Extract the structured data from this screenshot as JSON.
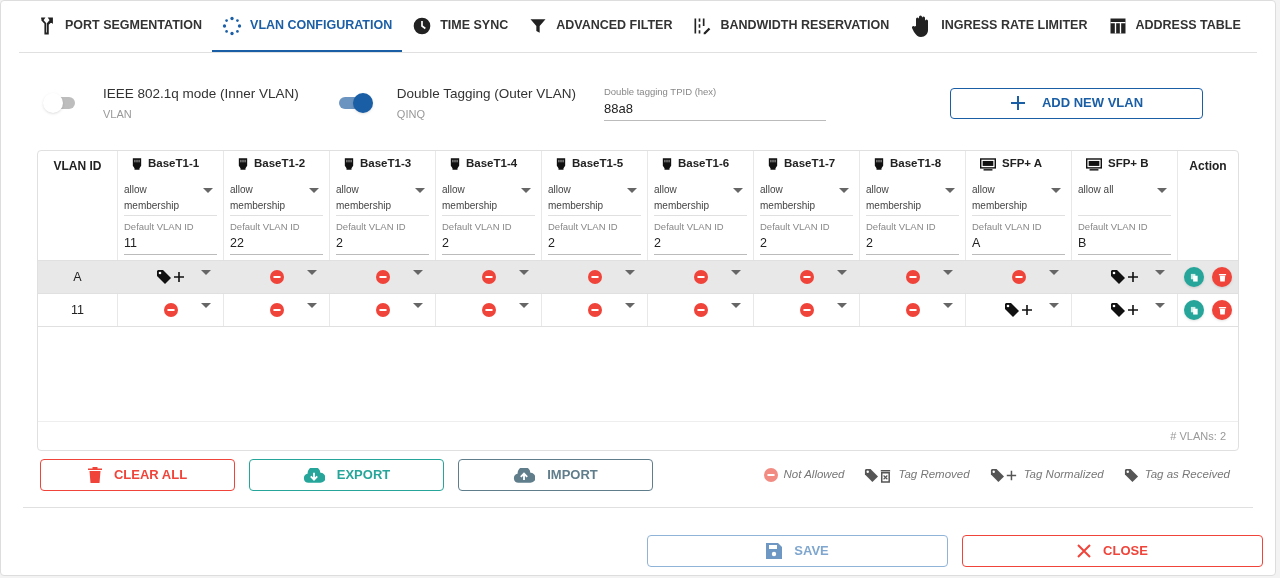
{
  "tabs": [
    {
      "label": "PORT SEGMENTATION",
      "kind": "fork",
      "selected": false
    },
    {
      "label": "VLAN CONFIGURATION",
      "kind": "dots",
      "selected": true
    },
    {
      "label": "TIME SYNC",
      "kind": "clock",
      "selected": false
    },
    {
      "label": "ADVANCED FILTER",
      "kind": "filter",
      "selected": false
    },
    {
      "label": "BANDWIDTH RESERVATION",
      "kind": "bars",
      "selected": false
    },
    {
      "label": "INGRESS RATE LIMITER",
      "kind": "hand",
      "selected": false
    },
    {
      "label": "ADDRESS TABLE",
      "kind": "table",
      "selected": false
    }
  ],
  "modes": [
    {
      "label": "IEEE 802.1q mode (Inner VLAN)",
      "sublabel": "VLAN",
      "on": false
    },
    {
      "label": "Double Tagging (Outer VLAN)",
      "sublabel": "QINQ",
      "on": true
    }
  ],
  "tpid_field": {
    "label": "Double tagging TPID (hex)",
    "value": "88a8"
  },
  "add_button": "ADD NEW VLAN",
  "table": {
    "id_heading": "VLAN ID",
    "action_heading": "Action",
    "ports": [
      {
        "name": "BaseT1-1",
        "kind": "ethernet",
        "mode": "allow membership",
        "default_label": "Default VLAN ID",
        "default_vlan": "11"
      },
      {
        "name": "BaseT1-2",
        "kind": "ethernet",
        "mode": "allow membership",
        "default_label": "Default VLAN ID",
        "default_vlan": "22"
      },
      {
        "name": "BaseT1-3",
        "kind": "ethernet",
        "mode": "allow membership",
        "default_label": "Default VLAN ID",
        "default_vlan": "2"
      },
      {
        "name": "BaseT1-4",
        "kind": "ethernet",
        "mode": "allow membership",
        "default_label": "Default VLAN ID",
        "default_vlan": "2"
      },
      {
        "name": "BaseT1-5",
        "kind": "ethernet",
        "mode": "allow membership",
        "default_label": "Default VLAN ID",
        "default_vlan": "2"
      },
      {
        "name": "BaseT1-6",
        "kind": "ethernet",
        "mode": "allow membership",
        "default_label": "Default VLAN ID",
        "default_vlan": "2"
      },
      {
        "name": "BaseT1-7",
        "kind": "ethernet",
        "mode": "allow membership",
        "default_label": "Default VLAN ID",
        "default_vlan": "2"
      },
      {
        "name": "BaseT1-8",
        "kind": "ethernet",
        "mode": "allow membership",
        "default_label": "Default VLAN ID",
        "default_vlan": "2"
      },
      {
        "name": "SFP+ A",
        "kind": "sfp",
        "mode": "allow membership",
        "default_label": "Default VLAN ID",
        "default_vlan": "A"
      },
      {
        "name": "SFP+ B",
        "kind": "sfp",
        "mode": "allow all",
        "default_label": "Default VLAN ID",
        "default_vlan": "B"
      }
    ],
    "rows": [
      {
        "vlan_id": "A",
        "selected": true,
        "cells": [
          {
            "kind": "tag_normalized"
          },
          {
            "kind": "not_allowed"
          },
          {
            "kind": "not_allowed"
          },
          {
            "kind": "not_allowed"
          },
          {
            "kind": "not_allowed"
          },
          {
            "kind": "not_allowed"
          },
          {
            "kind": "not_allowed"
          },
          {
            "kind": "not_allowed"
          },
          {
            "kind": "not_allowed"
          },
          {
            "kind": "tag_normalized"
          }
        ]
      },
      {
        "vlan_id": "11",
        "selected": false,
        "cells": [
          {
            "kind": "not_allowed"
          },
          {
            "kind": "not_allowed"
          },
          {
            "kind": "not_allowed"
          },
          {
            "kind": "not_allowed"
          },
          {
            "kind": "not_allowed"
          },
          {
            "kind": "not_allowed"
          },
          {
            "kind": "not_allowed"
          },
          {
            "kind": "not_allowed"
          },
          {
            "kind": "tag_normalized"
          },
          {
            "kind": "tag_normalized"
          }
        ]
      }
    ],
    "count": "# VLANs: 2"
  },
  "actions": [
    {
      "label": "CLEAR ALL",
      "kind": "clear"
    },
    {
      "label": "EXPORT",
      "kind": "export"
    },
    {
      "label": "IMPORT",
      "kind": "import"
    }
  ],
  "legend": [
    {
      "label": "Not Allowed",
      "kind": "not_allowed"
    },
    {
      "label": "Tag Removed",
      "kind": "tag_removed"
    },
    {
      "label": "Tag Normalized",
      "kind": "tag_normalized"
    },
    {
      "label": "Tag as Received",
      "kind": "tag_received"
    }
  ],
  "footer_buttons": [
    {
      "label": "SAVE",
      "kind": "save"
    },
    {
      "label": "CLOSE",
      "kind": "close"
    }
  ]
}
